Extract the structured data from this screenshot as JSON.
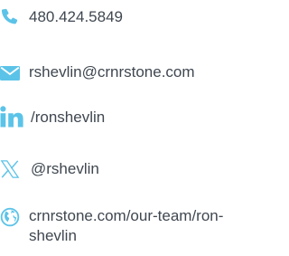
{
  "contact": {
    "phone": "480.424.5849",
    "email": "rshevlin@crnrstone.com",
    "linkedin": "/ronshevlin",
    "x_handle": "@rshevlin",
    "website": "crnrstone.com/our-team/ron-shevlin"
  },
  "icons": {
    "phone": "phone-icon",
    "email": "envelope-icon",
    "linkedin": "linkedin-icon",
    "x": "x-logo-icon",
    "website": "globe-icon"
  },
  "colors": {
    "accent": "#5cc3e8",
    "text": "#3f4750"
  }
}
